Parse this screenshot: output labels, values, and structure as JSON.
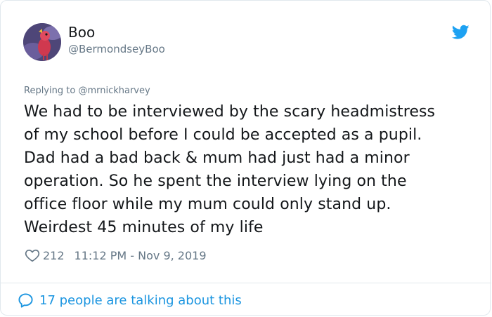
{
  "user": {
    "display_name": "Boo",
    "handle": "@BermondseyBoo"
  },
  "reply": {
    "prefix": "Replying to ",
    "mention": "@mrnickharvey"
  },
  "tweet": {
    "lines": [
      "We had to be interviewed by the scary headmistress",
      "of my school before I could be accepted as a pupil.",
      "Dad had a bad back & mum had just had a minor",
      "operation. So he spent the interview lying on the",
      "office floor while my mum could only stand up.",
      "Weirdest 45 minutes of my life"
    ]
  },
  "meta": {
    "likes": "212",
    "timestamp": "11:12 PM - Nov 9, 2019"
  },
  "footer": {
    "talking": "17 people are talking about this"
  },
  "colors": {
    "text": "#14171a",
    "secondary": "#657786",
    "twitter_blue": "#1da1f2",
    "link_blue": "#1b95e0",
    "border": "#e1e8ed"
  },
  "icons": {
    "brand": "twitter-bird-icon",
    "like": "heart-icon",
    "conversation": "speech-bubble-icon"
  }
}
